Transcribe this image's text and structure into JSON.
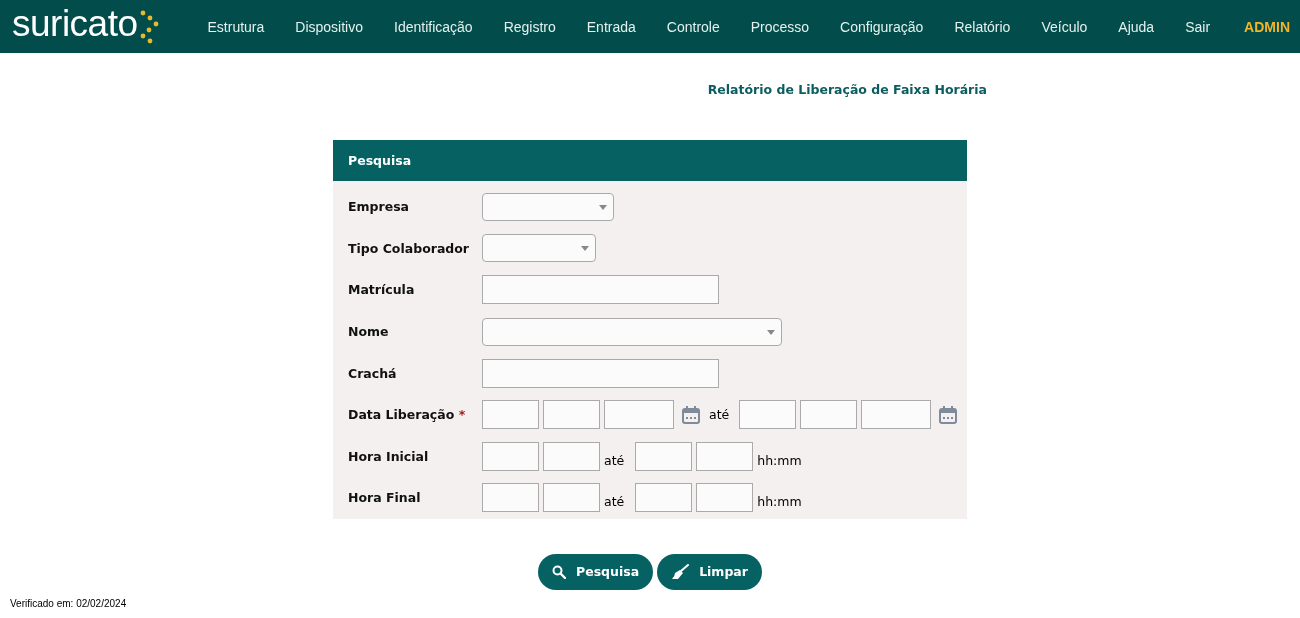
{
  "header": {
    "logo": "suricato",
    "menu": [
      "Estrutura",
      "Dispositivo",
      "Identificação",
      "Registro",
      "Entrada",
      "Controle",
      "Processo",
      "Configuração",
      "Relatório",
      "Veículo",
      "Ajuda",
      "Sair"
    ],
    "user": "ADMIN"
  },
  "page_title": "Relatório de Liberação de Faixa Horária",
  "panel": {
    "title": "Pesquisa",
    "fields": [
      {
        "kind": "select",
        "label": "Empresa"
      },
      {
        "kind": "select",
        "label": "Tipo Colaborador"
      },
      {
        "kind": "text",
        "label": "Matrícula"
      },
      {
        "kind": "select",
        "label": "Nome"
      },
      {
        "kind": "text",
        "label": "Crachá"
      },
      {
        "kind": "date",
        "label": "Data Liberação",
        "required": true,
        "required_mark": "*",
        "separator": "até"
      },
      {
        "kind": "time",
        "label": "Hora Inicial",
        "separator": "até",
        "hint": "hh:mm"
      },
      {
        "kind": "time",
        "label": "Hora Final",
        "separator": "até",
        "hint": "hh:mm"
      }
    ]
  },
  "buttons": [
    {
      "kind": "search",
      "label": "Pesquisa"
    },
    {
      "kind": "clear",
      "label": "Limpar"
    }
  ],
  "footer": "Verificado em: 02/02/2024"
}
